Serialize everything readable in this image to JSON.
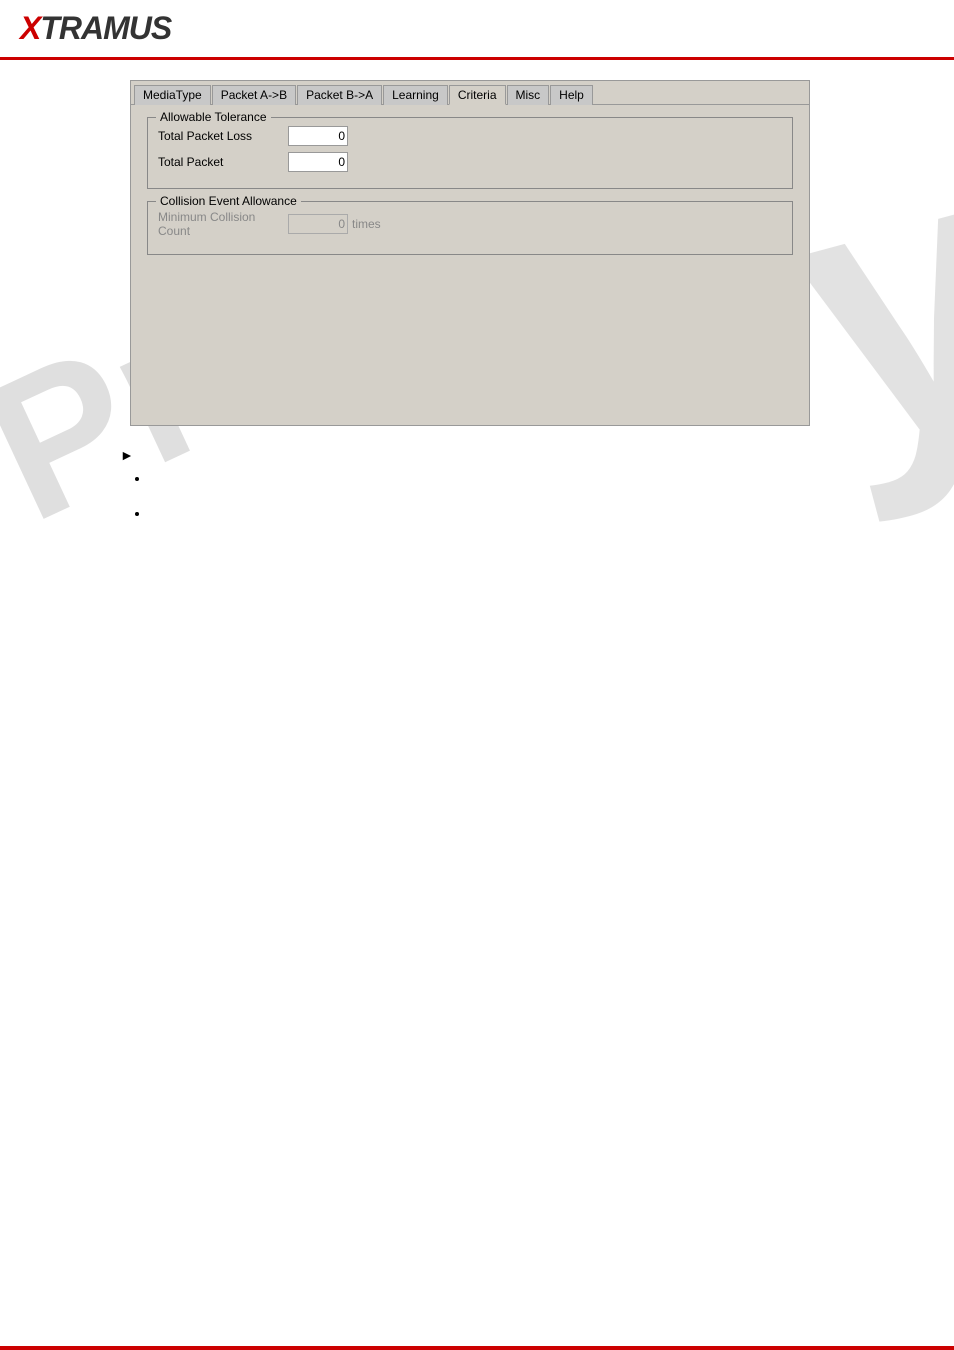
{
  "header": {
    "logo_x": "X",
    "logo_text": "TRAMUS"
  },
  "tabs": {
    "items": [
      {
        "label": "MediaType",
        "active": false
      },
      {
        "label": "Packet A->B",
        "active": false
      },
      {
        "label": "Packet B->A",
        "active": false
      },
      {
        "label": "Learning",
        "active": false
      },
      {
        "label": "Criteria",
        "active": true
      },
      {
        "label": "Misc",
        "active": false
      },
      {
        "label": "Help",
        "active": false
      }
    ]
  },
  "criteria": {
    "allowable_tolerance": {
      "group_label": "Allowable Tolerance",
      "total_packet_loss_label": "Total Packet Loss",
      "total_packet_loss_value": "0",
      "total_packet_label": "Total Packet",
      "total_packet_value": "0"
    },
    "collision_event": {
      "group_label": "Collision Event Allowance",
      "minimum_collision_label": "Minimum Collision Count",
      "minimum_collision_value": "0",
      "times_suffix": "times"
    }
  },
  "watermarks": {
    "prelim": "Prelim",
    "right_letter": "y"
  },
  "notes": {
    "arrow_text": "",
    "bullets": [
      "",
      ""
    ]
  }
}
